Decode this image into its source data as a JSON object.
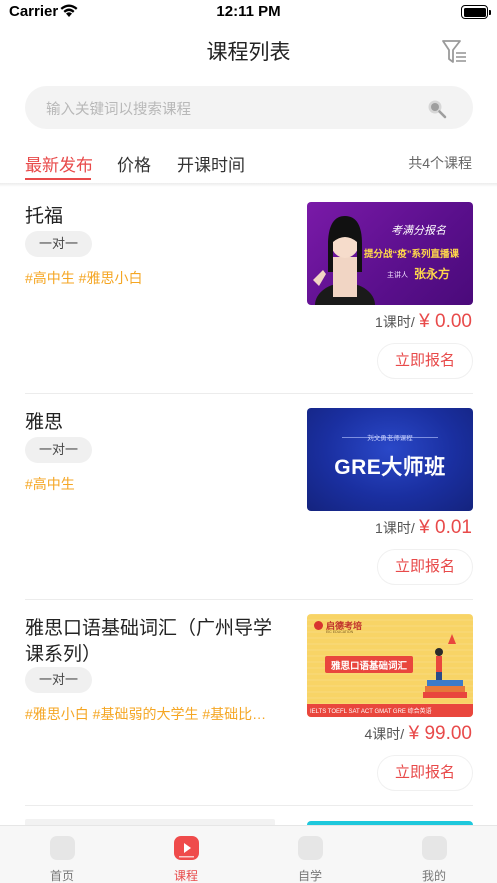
{
  "status_bar": {
    "carrier": "Carrier",
    "time": "12:11 PM"
  },
  "header": {
    "title": "课程列表",
    "filter_icon": "filter-icon"
  },
  "search": {
    "placeholder": "输入关键词以搜索课程",
    "icon": "search-icon"
  },
  "sort_tabs": {
    "items": [
      {
        "label": "最新发布",
        "active": true
      },
      {
        "label": "价格",
        "active": false
      },
      {
        "label": "开课时间",
        "active": false
      }
    ],
    "count_text": "共4个课程"
  },
  "courses": [
    {
      "title": "托福",
      "type": "一对一",
      "tags": "#高中生 #雅思小白",
      "lessons": "1课时/",
      "price": "¥ 0.00",
      "signup_label": "立即报名",
      "thumb": {
        "brand": "考满分报名",
        "headline": "提分战“疫”系列直播课",
        "presenter_label": "主讲人",
        "presenter": "张永方"
      }
    },
    {
      "title": "雅思",
      "type": "一对一",
      "tags": "#高中生",
      "lessons": "1课时/",
      "price": "¥ 0.01",
      "signup_label": "立即报名",
      "thumb": {
        "subtitle": "刘文勇老师课程",
        "headline": "GRE大师班"
      }
    },
    {
      "title": "雅思口语基础词汇（广州导学课系列）",
      "type": "一对一",
      "tags": "#雅思小白 #基础弱的大学生 #基础比…",
      "lessons": "4课时/",
      "price": "¥ 99.00",
      "signup_label": "立即报名",
      "thumb": {
        "brand": "启德考培",
        "brand_en": "EIC EDUCATION",
        "headline": "雅思口语基础词汇",
        "footer": "IELTS TOEFL SAT ACT GMAT GRE  综合英语"
      }
    }
  ],
  "tab_bar": {
    "items": [
      {
        "label": "首页",
        "icon": "home-icon",
        "active": false
      },
      {
        "label": "课程",
        "icon": "course-play-icon",
        "active": true
      },
      {
        "label": "自学",
        "icon": "self-study-icon",
        "active": false
      },
      {
        "label": "我的",
        "icon": "profile-icon",
        "active": false
      }
    ]
  },
  "colors": {
    "accent": "#e84a4a",
    "tag": "#f5a623",
    "search_bg": "#f3f3f3"
  }
}
